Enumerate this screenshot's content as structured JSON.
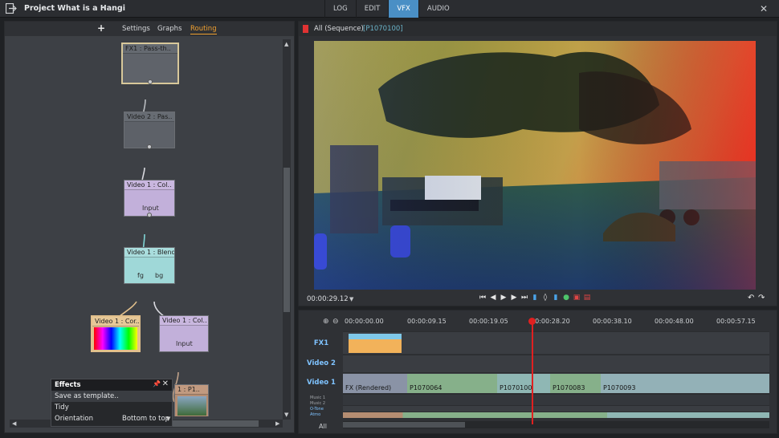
{
  "app": {
    "project_title": "Project What is a Hangi",
    "mode_tabs": [
      {
        "label": "LOG",
        "active": false
      },
      {
        "label": "EDIT",
        "active": false
      },
      {
        "label": "VFX",
        "active": true
      },
      {
        "label": "AUDIO",
        "active": false
      }
    ]
  },
  "left_panel": {
    "add_symbol": "+",
    "tabs": [
      {
        "label": "Settings",
        "active": false
      },
      {
        "label": "Graphs",
        "active": false
      },
      {
        "label": "Routing",
        "active": true
      }
    ]
  },
  "nodes": [
    {
      "id": "fx1",
      "title": "FX1 : Pass-th..",
      "sub": ""
    },
    {
      "id": "video2",
      "title": "Video 2 : Pas..",
      "sub": ""
    },
    {
      "id": "video1-col",
      "title": "Video 1 : Col..",
      "sub": "Input"
    },
    {
      "id": "blend",
      "title": "Video 1 : Blend",
      "sub_fg": "fg",
      "sub_bg": "bg"
    },
    {
      "id": "video1-cor",
      "title": "Video 1 : Cor..",
      "sub": ""
    },
    {
      "id": "video1-col2",
      "title": "Video 1 : Col..",
      "sub": "Input"
    },
    {
      "id": "video1-p1",
      "title": "1 : P1..",
      "sub": ""
    }
  ],
  "effects_popup": {
    "title": "Effects",
    "items": [
      {
        "label": "Save as template.."
      },
      {
        "label": "Tidy"
      },
      {
        "label": "Orientation"
      }
    ],
    "orientation_value": "Bottom to top"
  },
  "viewer": {
    "sequence_label": "All (Sequence)",
    "clip_id": "[P1070100]",
    "timecode": "00:00:29.12"
  },
  "timeline": {
    "ruler": [
      "00:00:00.00",
      "00:00:09.15",
      "00:00:19.05",
      "00:00:28.20",
      "00:00:38.10",
      "00:00:48.00",
      "00:00:57.15"
    ],
    "tracks": {
      "fx1": "FX1",
      "video2": "Video 2",
      "video1": "Video 1",
      "all": "All"
    },
    "mini_tracks": [
      "Music 1",
      "Music 2",
      "O-Tone",
      "Atmo"
    ],
    "clips": [
      {
        "label": "FX (Rendered)",
        "color": "#8a93a6"
      },
      {
        "label": "P1070064",
        "color": "#86b08a"
      },
      {
        "label": "P1070100",
        "color": "#8fb7b4"
      },
      {
        "label": "P1070083",
        "color": "#86b08a"
      },
      {
        "label": "P1070093",
        "color": "#93b1b7"
      }
    ]
  },
  "colors": {
    "accent_blue": "#4a8fc5",
    "routing_orange": "#f0a030",
    "playhead_red": "#e02020",
    "track_label_blue": "#7fc3ff"
  },
  "icons": [
    "exit-icon",
    "close-icon",
    "pin-icon",
    "zoom-in-icon",
    "zoom-out-icon",
    "undo-icon",
    "redo-icon"
  ]
}
